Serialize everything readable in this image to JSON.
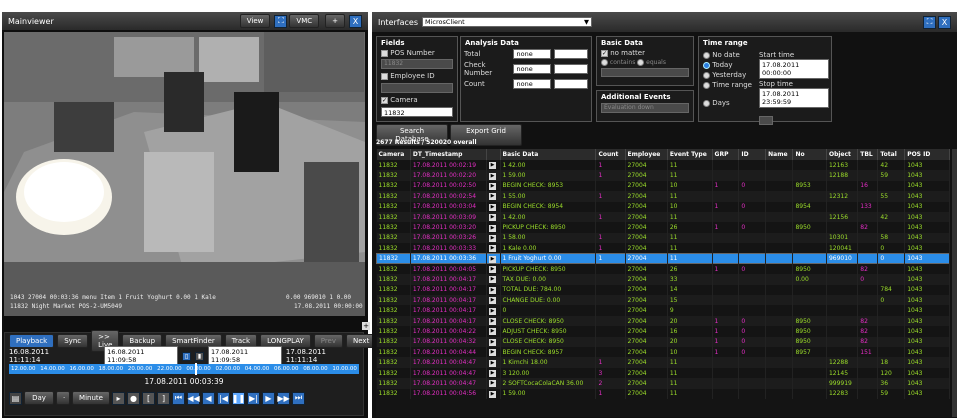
{
  "mainviewer": {
    "title": "Mainviewer",
    "view_label": "View",
    "vmc_label": "VMC",
    "plus_label": "+",
    "close_label": "X",
    "minimize_label": "■"
  },
  "camera": {
    "overlay_line1": "1043  27004  00:03:36   menu  Item   1   Fruit  Yoghurt          0.00   1   Kale",
    "overlay_line1_right": "0.00  969010  1   0.00",
    "overlay_line2": "11832   Night   Market   POS-2-UM5049",
    "overlay_line2_right": "17.08.2011  00:00:00"
  },
  "playback": {
    "tab_label": "Playback",
    "sync_label": "Sync",
    "live_label": ">> Live",
    "backup_label": "Backup",
    "smartfinder_label": "SmartFinder",
    "track_label": "Track",
    "mode_label": "LONGPLAY",
    "prev_label": "Prev",
    "next_label": "Next",
    "range_start": "16.08.2011 11:11:14",
    "from_time": "16.08.2011 11:09:58",
    "to_time": "17.08.2011 11:09:58",
    "range_end": "17.08.2011 11:11:14",
    "timeline_ticks": [
      "12.00.00",
      "14.00.00",
      "16.00.00",
      "18.00.00",
      "20.00.00",
      "22.00.00",
      "00.00.00",
      "02.00.00",
      "04.00.00",
      "06.00.00",
      "08.00.00",
      "10.00.00"
    ],
    "current_time": "17.08.2011 00:03:39",
    "day_label": "Day",
    "minute_label": "Minute"
  },
  "interfaces": {
    "title": "Interfaces",
    "client_value": "MicrosClient"
  },
  "fields": {
    "title": "Fields",
    "pos_label": "POS Number",
    "pos_value": "11832",
    "employee_label": "Employee ID",
    "camera_label": "Camera",
    "camera_value": "11832"
  },
  "analysis": {
    "title": "Analysis Data",
    "total_label": "Total",
    "check_label": "Check Number",
    "count_label": "Count",
    "none_value": "none"
  },
  "basic": {
    "title": "Basic Data",
    "no_matter_label": "no matter",
    "contains_label": "contains",
    "equals_label": "equals"
  },
  "additional": {
    "title": "Additional Events",
    "dropdown_value": "Evaluation down"
  },
  "timerange": {
    "title": "Time range",
    "no_date": "No date",
    "today": "Today",
    "yesterday": "Yesterday",
    "time_range": "Time range",
    "days": "Days",
    "start_label": "Start time",
    "start_value": "17.08.2011 00:00:00",
    "stop_label": "Stop time",
    "stop_value": "17.08.2011 23:59:59"
  },
  "actions": {
    "search_label": "Search Database",
    "export_label": "Export Grid"
  },
  "results": {
    "summary": "2677 Results / 520020 overall",
    "columns": [
      "Camera",
      "DT_Timestamp",
      "",
      "Basic Data",
      "Count",
      "Employee",
      "Event Type",
      "GRP",
      "ID",
      "Name",
      "No",
      "Object",
      "TBL",
      "Total",
      "POS ID"
    ],
    "rows": [
      {
        "cam": "11832",
        "ts": "17.08.2011 00:02:19",
        "basic": "1          42.00",
        "count": "1",
        "emp": "27004",
        "evt": "11",
        "grp": "",
        "id": "",
        "name": "",
        "no": "",
        "obj": "12163",
        "tbl": "",
        "total": "42",
        "pos": "1043"
      },
      {
        "cam": "11832",
        "ts": "17.08.2011 00:02:20",
        "basic": "1          59.00",
        "count": "1",
        "emp": "27004",
        "evt": "11",
        "grp": "",
        "id": "",
        "name": "",
        "no": "",
        "obj": "12188",
        "tbl": "",
        "total": "59",
        "pos": "1043"
      },
      {
        "cam": "11832",
        "ts": "17.08.2011 00:02:50",
        "basic": "BEGIN CHECK: 8953",
        "count": "",
        "emp": "27004",
        "evt": "10",
        "grp": "1",
        "id": "0",
        "name": "",
        "no": "8953",
        "obj": "",
        "tbl": "16",
        "total": "",
        "pos": "1043"
      },
      {
        "cam": "11832",
        "ts": "17.08.2011 00:02:54",
        "basic": "1          55.00",
        "count": "1",
        "emp": "27004",
        "evt": "11",
        "grp": "",
        "id": "",
        "name": "",
        "no": "",
        "obj": "12312",
        "tbl": "",
        "total": "55",
        "pos": "1043"
      },
      {
        "cam": "11832",
        "ts": "17.08.2011 00:03:04",
        "basic": "BEGIN CHECK: 8954",
        "count": "",
        "emp": "27004",
        "evt": "10",
        "grp": "1",
        "id": "0",
        "name": "",
        "no": "8954",
        "obj": "",
        "tbl": "133",
        "total": "",
        "pos": "1043"
      },
      {
        "cam": "11832",
        "ts": "17.08.2011 00:03:09",
        "basic": "1          42.00",
        "count": "1",
        "emp": "27004",
        "evt": "11",
        "grp": "",
        "id": "",
        "name": "",
        "no": "",
        "obj": "12156",
        "tbl": "",
        "total": "42",
        "pos": "1043"
      },
      {
        "cam": "11832",
        "ts": "17.08.2011 00:03:20",
        "basic": "PICKUP CHECK: 8950",
        "count": "",
        "emp": "27004",
        "evt": "26",
        "grp": "1",
        "id": "0",
        "name": "",
        "no": "8950",
        "obj": "",
        "tbl": "82",
        "total": "",
        "pos": "1043"
      },
      {
        "cam": "11832",
        "ts": "17.08.2011 00:03:26",
        "basic": "1          58.00",
        "count": "1",
        "emp": "27004",
        "evt": "11",
        "grp": "",
        "id": "",
        "name": "",
        "no": "",
        "obj": "10301",
        "tbl": "",
        "total": "58",
        "pos": "1043"
      },
      {
        "cam": "11832",
        "ts": "17.08.2011 00:03:33",
        "basic": "1 Kale        0.00",
        "count": "1",
        "emp": "27004",
        "evt": "11",
        "grp": "",
        "id": "",
        "name": "",
        "no": "",
        "obj": "120041",
        "tbl": "",
        "total": "0",
        "pos": "1043"
      },
      {
        "cam": "11832",
        "ts": "17.08.2011 00:03:36",
        "basic": "1 Fruit Yoghurt   0.00",
        "count": "1",
        "emp": "27004",
        "evt": "11",
        "grp": "",
        "id": "",
        "name": "",
        "no": "",
        "obj": "969010",
        "tbl": "",
        "total": "0",
        "pos": "1043",
        "selected": true
      },
      {
        "cam": "11832",
        "ts": "17.08.2011 00:04:05",
        "basic": "PICKUP CHECK: 8950",
        "count": "",
        "emp": "27004",
        "evt": "26",
        "grp": "1",
        "id": "0",
        "name": "",
        "no": "8950",
        "obj": "",
        "tbl": "82",
        "total": "",
        "pos": "1043"
      },
      {
        "cam": "11832",
        "ts": "17.08.2011 00:04:17",
        "basic": "TAX DUE:    0.00",
        "count": "",
        "emp": "27004",
        "evt": "33",
        "grp": "",
        "id": "",
        "name": "",
        "no": "0.00",
        "obj": "",
        "tbl": "0",
        "total": "",
        "pos": "1043"
      },
      {
        "cam": "11832",
        "ts": "17.08.2011 00:04:17",
        "basic": "TOTAL DUE:   784.00",
        "count": "",
        "emp": "27004",
        "evt": "14",
        "grp": "",
        "id": "",
        "name": "",
        "no": "",
        "obj": "",
        "tbl": "",
        "total": "784",
        "pos": "1043"
      },
      {
        "cam": "11832",
        "ts": "17.08.2011 00:04:17",
        "basic": "CHANGE DUE:   0.00",
        "count": "",
        "emp": "27004",
        "evt": "15",
        "grp": "",
        "id": "",
        "name": "",
        "no": "",
        "obj": "",
        "tbl": "",
        "total": "0",
        "pos": "1043"
      },
      {
        "cam": "11832",
        "ts": "17.08.2011 00:04:17",
        "basic": "0",
        "count": "",
        "emp": "27004",
        "evt": "9",
        "grp": "",
        "id": "",
        "name": "",
        "no": "",
        "obj": "",
        "tbl": "",
        "total": "",
        "pos": "1043"
      },
      {
        "cam": "11832",
        "ts": "17.08.2011 00:04:17",
        "basic": "CLOSE CHECK: 8950",
        "count": "",
        "emp": "27004",
        "evt": "20",
        "grp": "1",
        "id": "0",
        "name": "",
        "no": "8950",
        "obj": "",
        "tbl": "82",
        "total": "",
        "pos": "1043"
      },
      {
        "cam": "11832",
        "ts": "17.08.2011 00:04:22",
        "basic": "ADJUST CHECK: 8950",
        "count": "",
        "emp": "27004",
        "evt": "16",
        "grp": "1",
        "id": "0",
        "name": "",
        "no": "8950",
        "obj": "",
        "tbl": "82",
        "total": "",
        "pos": "1043"
      },
      {
        "cam": "11832",
        "ts": "17.08.2011 00:04:32",
        "basic": "CLOSE CHECK: 8950",
        "count": "",
        "emp": "27004",
        "evt": "20",
        "grp": "1",
        "id": "0",
        "name": "",
        "no": "8950",
        "obj": "",
        "tbl": "82",
        "total": "",
        "pos": "1043"
      },
      {
        "cam": "11832",
        "ts": "17.08.2011 00:04:44",
        "basic": "BEGIN CHECK: 8957",
        "count": "",
        "emp": "27004",
        "evt": "10",
        "grp": "1",
        "id": "0",
        "name": "",
        "no": "8957",
        "obj": "",
        "tbl": "151",
        "total": "",
        "pos": "1043"
      },
      {
        "cam": "11832",
        "ts": "17.08.2011 00:04:47",
        "basic": "1 Kimchi      18.00",
        "count": "1",
        "emp": "27004",
        "evt": "11",
        "grp": "",
        "id": "",
        "name": "",
        "no": "",
        "obj": "12288",
        "tbl": "",
        "total": "18",
        "pos": "1043"
      },
      {
        "cam": "11832",
        "ts": "17.08.2011 00:04:47",
        "basic": "3          120.00",
        "count": "3",
        "emp": "27004",
        "evt": "11",
        "grp": "",
        "id": "",
        "name": "",
        "no": "",
        "obj": "12145",
        "tbl": "",
        "total": "120",
        "pos": "1043"
      },
      {
        "cam": "11832",
        "ts": "17.08.2011 00:04:47",
        "basic": "2 SOFTCocaColaCAN 36.00",
        "count": "2",
        "emp": "27004",
        "evt": "11",
        "grp": "",
        "id": "",
        "name": "",
        "no": "",
        "obj": "999919",
        "tbl": "",
        "total": "36",
        "pos": "1043"
      },
      {
        "cam": "11832",
        "ts": "17.08.2011 00:04:56",
        "basic": "1          59.00",
        "count": "1",
        "emp": "27004",
        "evt": "11",
        "grp": "",
        "id": "",
        "name": "",
        "no": "",
        "obj": "12283",
        "tbl": "",
        "total": "59",
        "pos": "1043"
      }
    ]
  },
  "colors": {
    "accent": "#2b8de8",
    "green": "#9cde2a",
    "magenta": "#e52ec5"
  }
}
